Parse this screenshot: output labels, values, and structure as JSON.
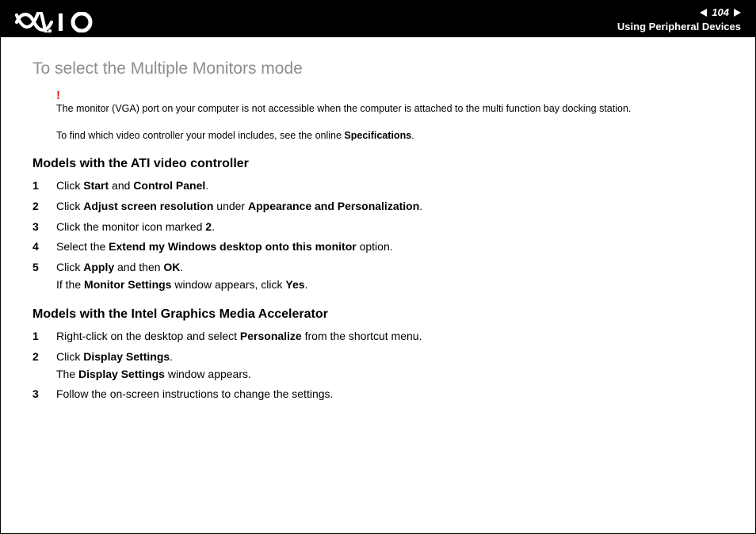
{
  "header": {
    "page_number": "104",
    "section": "Using Peripheral Devices"
  },
  "title": "To select the Multiple Monitors mode",
  "notice_bang": "!",
  "notice_text": "The monitor (VGA) port on your computer is not accessible when the computer is attached to the multi function bay docking station.",
  "spec_line_a": "To find which video controller your model includes, see the online ",
  "spec_line_b": "Specifications",
  "spec_line_c": ".",
  "ati": {
    "heading": "Models with the ATI video controller",
    "s1a": "Click ",
    "s1b": "Start",
    "s1c": " and ",
    "s1d": "Control Panel",
    "s1e": ".",
    "s2a": "Click ",
    "s2b": "Adjust screen resolution",
    "s2c": " under ",
    "s2d": "Appearance and Personalization",
    "s2e": ".",
    "s3a": "Click the monitor icon marked ",
    "s3b": "2",
    "s3c": ".",
    "s4a": "Select the ",
    "s4b": "Extend my Windows desktop onto this monitor",
    "s4c": " option.",
    "s5a": "Click ",
    "s5b": "Apply",
    "s5c": " and then ",
    "s5d": "OK",
    "s5e": ".",
    "s5f": "If the ",
    "s5g": "Monitor Settings",
    "s5h": " window appears, click ",
    "s5i": "Yes",
    "s5j": "."
  },
  "intel": {
    "heading": "Models with the Intel Graphics Media Accelerator",
    "s1a": "Right-click on the desktop and select ",
    "s1b": "Personalize",
    "s1c": " from the shortcut menu.",
    "s2a": "Click ",
    "s2b": "Display Settings",
    "s2c": ".",
    "s2d": "The ",
    "s2e": "Display Settings",
    "s2f": " window appears.",
    "s3a": "Follow the on-screen instructions to change the settings."
  },
  "nums": {
    "n1": "1",
    "n2": "2",
    "n3": "3",
    "n4": "4",
    "n5": "5"
  }
}
